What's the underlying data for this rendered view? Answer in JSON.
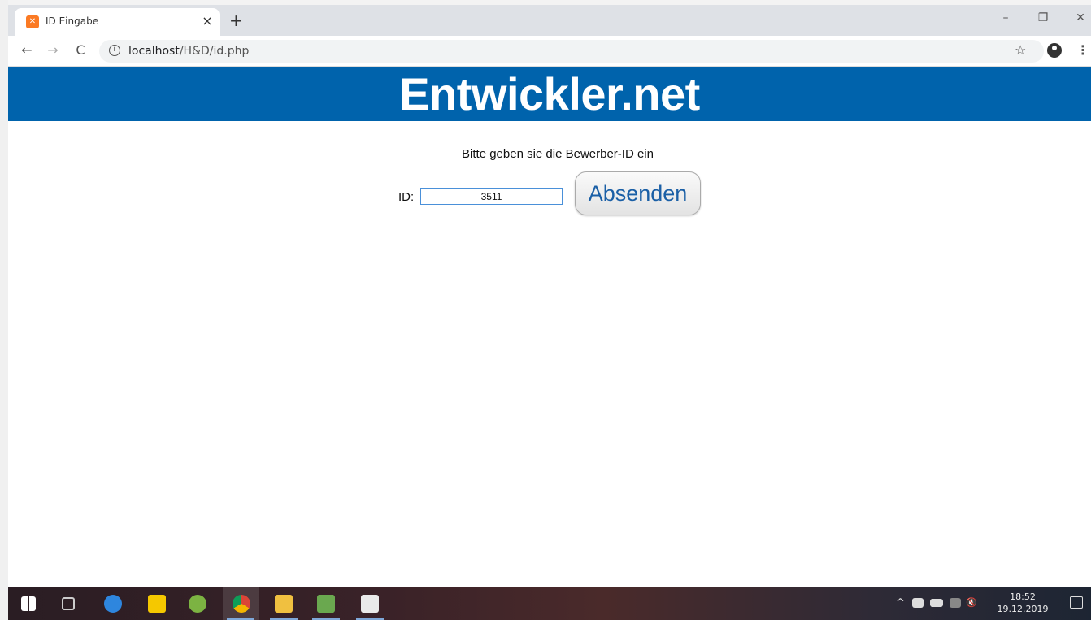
{
  "browser": {
    "tab_title": "ID Eingabe",
    "tab_close": "×",
    "new_tab": "+",
    "window_controls": {
      "minimize": "–",
      "restore": "❐",
      "close": "✕"
    },
    "nav": {
      "back": "←",
      "forward": "→",
      "reload": "C"
    },
    "url_host": "localhost",
    "url_path": "/H&D/id.php",
    "bookmark_icon": "☆",
    "menu_icon": "⋮"
  },
  "page": {
    "banner_title": "Entwickler.net",
    "prompt": "Bitte geben sie die Bewerber-ID ein",
    "id_label": "ID:",
    "id_value": "3511",
    "submit_label": "Absenden"
  },
  "taskbar": {
    "time": "18:52",
    "date": "19.12.2019",
    "tray_chevron": "^",
    "tray_sound": "🔇"
  },
  "colors": {
    "banner": "#0063ac",
    "button_text": "#1a5fa6"
  }
}
